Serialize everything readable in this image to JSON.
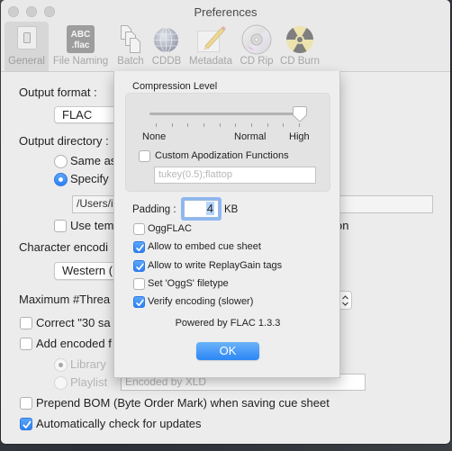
{
  "window": {
    "title": "Preferences"
  },
  "toolbar": {
    "items": [
      {
        "label": "General",
        "icon": "general-switch-icon",
        "selected": true
      },
      {
        "label": "File Naming",
        "icon": "file-naming-icon",
        "icon_text": [
          "ABC",
          ".flac"
        ],
        "selected": false
      },
      {
        "label": "Batch",
        "icon": "batch-documents-icon",
        "selected": false
      },
      {
        "label": "CDDB",
        "icon": "globe-icon",
        "selected": false
      },
      {
        "label": "Metadata",
        "icon": "pencil-note-icon",
        "selected": false
      },
      {
        "label": "CD Rip",
        "icon": "cd-disc-icon",
        "selected": false
      },
      {
        "label": "CD Burn",
        "icon": "radiation-burn-icon",
        "selected": false
      }
    ]
  },
  "general": {
    "output_format_label": "Output format :",
    "output_format_value": "FLAC",
    "output_directory_label": "Output directory :",
    "same_as_label": "Same as",
    "same_as_selected": false,
    "specify_label": "Specify",
    "specify_selected": true,
    "path_value": "/Users/i",
    "use_temp_label": "Use tem",
    "use_temp_suffix": "on",
    "use_temp_checked": false,
    "char_encoding_label": "Character encodi",
    "char_encoding_value": "Western (",
    "max_threads_label": "Maximum #Threa",
    "correct_label": "Correct \"30 sa",
    "correct_checked": false,
    "add_encoded_label": "Add encoded f",
    "add_encoded_checked": false,
    "library_label": "Library",
    "library_selected": true,
    "playlist_label": "Playlist",
    "playlist_selected": false,
    "playlist_placeholder": "Encoded by XLD",
    "prepend_bom_label": "Prepend BOM (Byte Order Mark) when saving cue sheet",
    "prepend_bom_checked": false,
    "auto_update_label": "Automatically check for updates",
    "auto_update_checked": true
  },
  "flac_sheet": {
    "compression_title": "Compression Level",
    "compression": {
      "tick_count": 10,
      "selected_index": 9,
      "labels": {
        "min": "None",
        "mid": "Normal",
        "max": "High"
      }
    },
    "custom_apod_label": "Custom Apodization Functions",
    "custom_apod_checked": false,
    "apod_value": "tukey(0.5);flattop",
    "padding_label": "Padding :",
    "padding_value": "4",
    "padding_unit": "KB",
    "options": [
      {
        "label": "OggFLAC",
        "checked": false
      },
      {
        "label": "Allow to embed cue sheet",
        "checked": true
      },
      {
        "label": "Allow to write ReplayGain tags",
        "checked": true
      },
      {
        "label": "Set 'OggS' filetype",
        "checked": false
      },
      {
        "label": "Verify encoding (slower)",
        "checked": true
      }
    ],
    "powered_by": "Powered by FLAC 1.3.3",
    "ok_label": "OK"
  },
  "colors": {
    "accent": "#2f80f3",
    "window_bg": "#ececec",
    "sheet_bg": "#eeeeee"
  }
}
